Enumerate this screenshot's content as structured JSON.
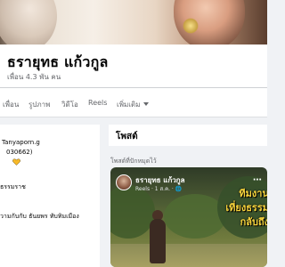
{
  "profile": {
    "name": "ธรายุทธ แก้วกูล",
    "friends": "เพื่อน 4.3 พัน คน"
  },
  "tabs": {
    "items": [
      {
        "label": "เพื่อน"
      },
      {
        "label": "รูปภาพ"
      },
      {
        "label": "วิดีโอ"
      },
      {
        "label": "Reels"
      },
      {
        "label": "เพิ่มเติม"
      }
    ]
  },
  "intro": {
    "line1": "Tanyaporn.g",
    "line2": "030662)",
    "line3": "ธรรมราช",
    "line4": "วามกับกับ ธันยพร ทับทิมเมือง"
  },
  "posts": {
    "title": "โพสต์",
    "pinned_label": "โพสต์ที่ปักหมุดไว้"
  },
  "reel": {
    "author": "ธรายุทธ แก้วกูล",
    "meta": "Reels · 1 ส.ค. · 🌐",
    "overlay_line1": "ทีมงาน",
    "overlay_line2": "เที่ยงธรรม",
    "overlay_line3": "กลับถึง"
  },
  "colors": {
    "heart": "#f7b928",
    "overlay_text": "#f7d33c"
  },
  "icons": {
    "heart": "heart-icon",
    "more": "more-horizontal-icon",
    "caret": "caret-down-icon"
  }
}
